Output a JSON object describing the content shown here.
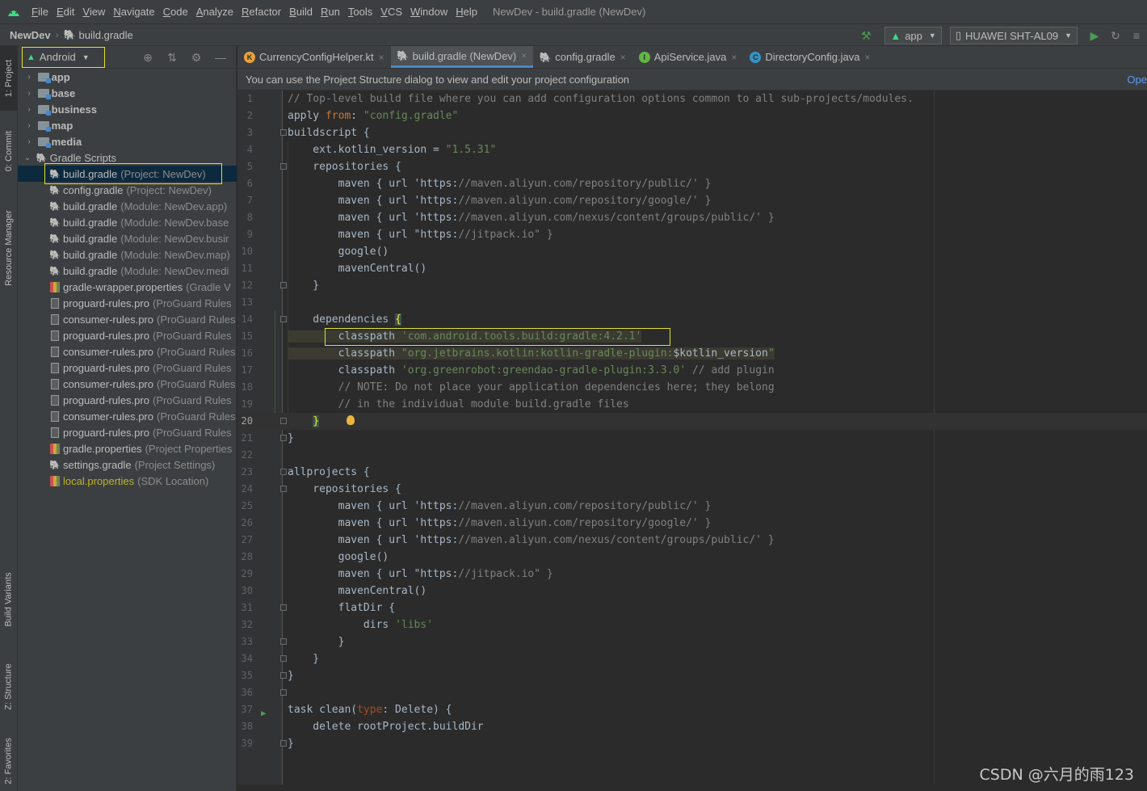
{
  "menubar": {
    "items": [
      "File",
      "Edit",
      "View",
      "Navigate",
      "Code",
      "Analyze",
      "Refactor",
      "Build",
      "Run",
      "Tools",
      "VCS",
      "Window",
      "Help"
    ],
    "window_title": "NewDev - build.gradle (NewDev)"
  },
  "navbar": {
    "root": "NewDev",
    "file": "build.gradle",
    "run_config": "app",
    "device": "HUAWEI SHT-AL09"
  },
  "left_strip": {
    "project": "1: Project",
    "commit": "0: Commit",
    "resource_manager": "Resource Manager",
    "build_variants": "Build Variants",
    "structure": "Z: Structure",
    "favorites": "2: Favorites"
  },
  "project_panel": {
    "view_mode": "Android",
    "tree": [
      {
        "name": "app",
        "hint": "",
        "kind": "module"
      },
      {
        "name": "base",
        "hint": "",
        "kind": "module"
      },
      {
        "name": "business",
        "hint": "",
        "kind": "module"
      },
      {
        "name": "map",
        "hint": "",
        "kind": "module"
      },
      {
        "name": "media",
        "hint": "",
        "kind": "module"
      },
      {
        "name": "Gradle Scripts",
        "hint": "",
        "kind": "group"
      },
      {
        "name": "build.gradle",
        "hint": "(Project: NewDev)",
        "kind": "gradle"
      },
      {
        "name": "config.gradle",
        "hint": "(Project: NewDev)",
        "kind": "gradle"
      },
      {
        "name": "build.gradle",
        "hint": "(Module: NewDev.app)",
        "kind": "gradle"
      },
      {
        "name": "build.gradle",
        "hint": "(Module: NewDev.base",
        "kind": "gradle"
      },
      {
        "name": "build.gradle",
        "hint": "(Module: NewDev.busir",
        "kind": "gradle"
      },
      {
        "name": "build.gradle",
        "hint": "(Module: NewDev.map)",
        "kind": "gradle"
      },
      {
        "name": "build.gradle",
        "hint": "(Module: NewDev.medi",
        "kind": "gradle"
      },
      {
        "name": "gradle-wrapper.properties",
        "hint": "(Gradle V",
        "kind": "props"
      },
      {
        "name": "proguard-rules.pro",
        "hint": "(ProGuard Rules",
        "kind": "file"
      },
      {
        "name": "consumer-rules.pro",
        "hint": "(ProGuard Rules",
        "kind": "file"
      },
      {
        "name": "proguard-rules.pro",
        "hint": "(ProGuard Rules",
        "kind": "file"
      },
      {
        "name": "consumer-rules.pro",
        "hint": "(ProGuard Rules",
        "kind": "file"
      },
      {
        "name": "proguard-rules.pro",
        "hint": "(ProGuard Rules",
        "kind": "file"
      },
      {
        "name": "consumer-rules.pro",
        "hint": "(ProGuard Rules",
        "kind": "file"
      },
      {
        "name": "proguard-rules.pro",
        "hint": "(ProGuard Rules",
        "kind": "file"
      },
      {
        "name": "consumer-rules.pro",
        "hint": "(ProGuard Rules",
        "kind": "file"
      },
      {
        "name": "proguard-rules.pro",
        "hint": "(ProGuard Rules",
        "kind": "file"
      },
      {
        "name": "gradle.properties",
        "hint": "(Project Properties",
        "kind": "props"
      },
      {
        "name": "settings.gradle",
        "hint": "(Project Settings)",
        "kind": "gradle"
      },
      {
        "name": "local.properties",
        "hint": "(SDK Location)",
        "kind": "props"
      }
    ]
  },
  "tabs": [
    {
      "label": "CurrencyConfigHelper.kt",
      "icon": "kotlin-icon",
      "active": false
    },
    {
      "label": "build.gradle (NewDev)",
      "icon": "gradle-icon",
      "active": true
    },
    {
      "label": "config.gradle",
      "icon": "gradle-icon",
      "active": false
    },
    {
      "label": "ApiService.java",
      "icon": "interface-icon",
      "active": false
    },
    {
      "label": "DirectoryConfig.java",
      "icon": "class-icon",
      "active": false
    }
  ],
  "banner": {
    "text": "You can use the Project Structure dialog to view and edit your project configuration",
    "link": "Ope"
  },
  "code": [
    "// Top-level build file where you can add configuration options common to all sub-projects/modules.",
    "apply from: \"config.gradle\"",
    "buildscript {",
    "    ext.kotlin_version = \"1.5.31\"",
    "    repositories {",
    "        maven { url 'https://maven.aliyun.com/repository/public/' }",
    "        maven { url 'https://maven.aliyun.com/repository/google/' }",
    "        maven { url 'https://maven.aliyun.com/nexus/content/groups/public/' }",
    "        maven { url \"https://jitpack.io\" }",
    "        google()",
    "        mavenCentral()",
    "    }",
    "",
    "    dependencies {",
    "        classpath 'com.android.tools.build:gradle:4.2.1'",
    "        classpath \"org.jetbrains.kotlin:kotlin-gradle-plugin:$kotlin_version\"",
    "        classpath 'org.greenrobot:greendao-gradle-plugin:3.3.0' // add plugin",
    "        // NOTE: Do not place your application dependencies here; they belong",
    "        // in the individual module build.gradle files",
    "    }",
    "}",
    "",
    "allprojects {",
    "    repositories {",
    "        maven { url 'https://maven.aliyun.com/repository/public/' }",
    "        maven { url 'https://maven.aliyun.com/repository/google/' }",
    "        maven { url 'https://maven.aliyun.com/nexus/content/groups/public/' }",
    "        google()",
    "        maven { url \"https://jitpack.io\" }",
    "        mavenCentral()",
    "        flatDir {",
    "            dirs 'libs'",
    "        }",
    "    }",
    "}",
    "",
    "task clean(type: Delete) {",
    "    delete rootProject.buildDir",
    "}"
  ],
  "current_line": 20,
  "watermark": "CSDN @六月的雨123",
  "colors": {
    "accent": "#4a88c7",
    "highlight_box": "#e2e22a",
    "string": "#6a8759",
    "comment": "#808080",
    "keyword": "#cc7832"
  }
}
